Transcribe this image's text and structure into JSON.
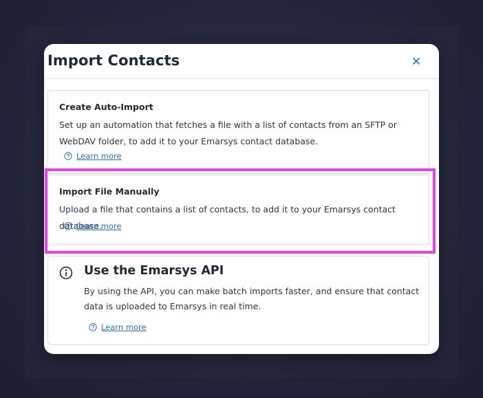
{
  "dialog": {
    "title": "Import Contacts",
    "close_label": "×"
  },
  "options": [
    {
      "title": "Create Auto-Import",
      "description": "Set up an automation that fetches a file with a list of contacts from an SFTP or WebDAV folder, to add it to your Emarsys contact database.",
      "link": "Learn more"
    },
    {
      "title": "Import File Manually",
      "description": "Upload a file that contains a list of contacts, to add it to your Emarsys contact database.",
      "link": "Learn more"
    }
  ],
  "api_panel": {
    "title": "Use the Emarsys API",
    "description": "By using the API, you can make batch imports faster, and ensure that contact data is uploaded to Emarsys in real time.",
    "link": "Learn more"
  },
  "colors": {
    "link": "#2a6ebb",
    "highlight": "#ee3cf0",
    "backdrop": "#24253b"
  }
}
